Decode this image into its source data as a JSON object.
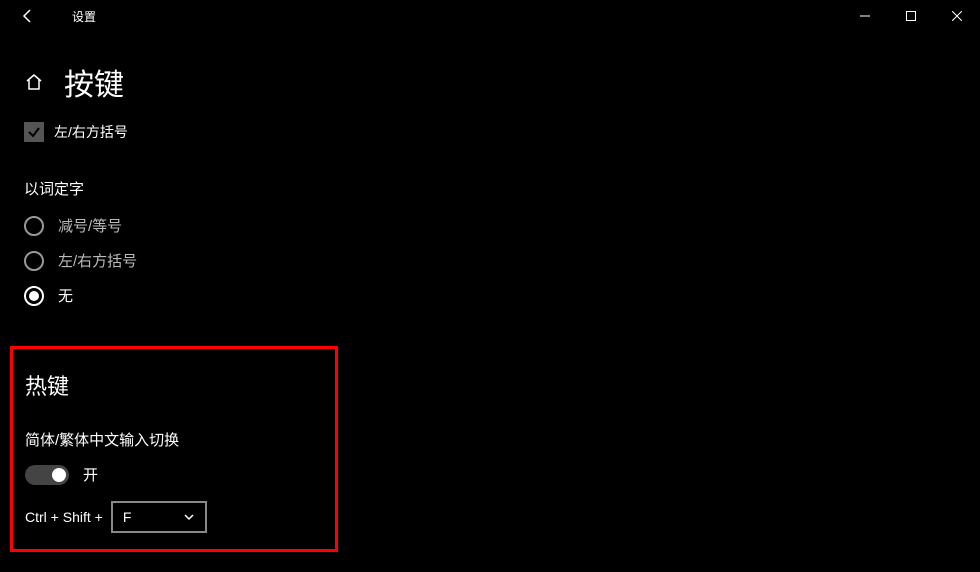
{
  "titlebar": {
    "title": "设置"
  },
  "page": {
    "title": "按键"
  },
  "checkbox": {
    "label": "左/右方括号"
  },
  "word_select": {
    "label": "以词定字",
    "options": [
      {
        "label": "减号/等号",
        "selected": false
      },
      {
        "label": "左/右方括号",
        "selected": false
      },
      {
        "label": "无",
        "selected": true
      }
    ]
  },
  "hotkey": {
    "title": "热键",
    "switch_label": "简体/繁体中文输入切换",
    "toggle_label": "开",
    "prefix": "Ctrl + Shift +",
    "dropdown_value": "F"
  }
}
